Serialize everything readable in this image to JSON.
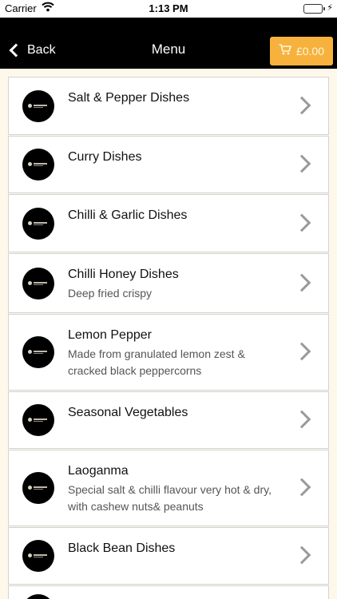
{
  "status_bar": {
    "carrier": "Carrier",
    "time": "1:13 PM"
  },
  "nav": {
    "back_label": "Back",
    "title": "Menu",
    "cart_amount": "£0.00"
  },
  "menu": {
    "items": [
      {
        "title": "Salt & Pepper Dishes",
        "subtitle": ""
      },
      {
        "title": "Curry Dishes",
        "subtitle": ""
      },
      {
        "title": "Chilli & Garlic Dishes",
        "subtitle": ""
      },
      {
        "title": "Chilli Honey Dishes",
        "subtitle": "Deep fried crispy"
      },
      {
        "title": "Lemon Pepper",
        "subtitle": "Made from granulated lemon zest & cracked black peppercorns"
      },
      {
        "title": "Seasonal Vegetables",
        "subtitle": ""
      },
      {
        "title": "Laoganma",
        "subtitle": "Special salt & chilli flavour very hot & dry, with cashew nuts& peanuts"
      },
      {
        "title": "Black Bean Dishes",
        "subtitle": ""
      }
    ]
  },
  "colors": {
    "nav_background": "#000000",
    "cart_button": "#f6b23c",
    "page_background": "#fdf8ea",
    "battery": "#4cd964"
  },
  "icons": {
    "back": "chevron-left-icon",
    "cart": "cart-icon",
    "row_chevron": "chevron-right-icon",
    "wifi": "wifi-icon",
    "battery": "battery-icon"
  }
}
